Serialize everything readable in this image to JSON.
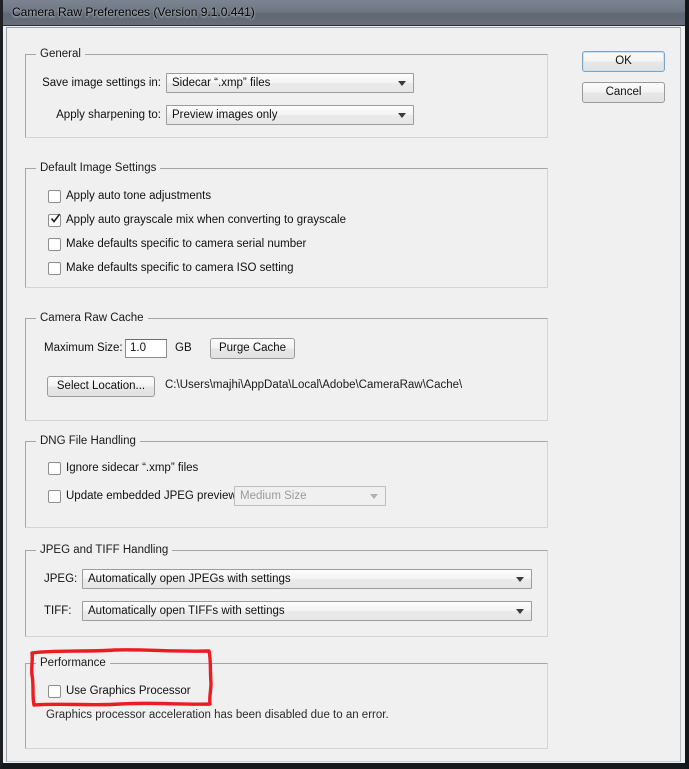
{
  "window": {
    "title": "Camera Raw Preferences  (Version 9.1.0.441)"
  },
  "buttons": {
    "ok": "OK",
    "cancel": "Cancel"
  },
  "groups": {
    "general": {
      "title": "General",
      "save_label": "Save image settings in:",
      "save_value": "Sidecar “.xmp” files",
      "sharpen_label": "Apply sharpening to:",
      "sharpen_value": "Preview images only"
    },
    "default_image_settings": {
      "title": "Default Image Settings",
      "items": [
        {
          "label": "Apply auto tone adjustments",
          "checked": false
        },
        {
          "label": "Apply auto grayscale mix when converting to grayscale",
          "checked": true
        },
        {
          "label": "Make defaults specific to camera serial number",
          "checked": false
        },
        {
          "label": "Make defaults specific to camera ISO setting",
          "checked": false
        }
      ]
    },
    "camera_raw_cache": {
      "title": "Camera Raw Cache",
      "max_size_label": "Maximum Size:",
      "max_size_value": "1.0",
      "unit_label": "GB",
      "purge_button": "Purge Cache",
      "select_location_button": "Select Location...",
      "cache_path": "C:\\Users\\majhi\\AppData\\Local\\Adobe\\CameraRaw\\Cache\\"
    },
    "dng_file_handling": {
      "title": "DNG File Handling",
      "ignore_sidecar": {
        "label": "Ignore sidecar “.xmp” files",
        "checked": false
      },
      "update_previews": {
        "label": "Update embedded JPEG previews:",
        "checked": false
      },
      "preview_size_value": "Medium Size"
    },
    "jpeg_tiff_handling": {
      "title": "JPEG and TIFF Handling",
      "jpeg_label": "JPEG:",
      "jpeg_value": "Automatically open JPEGs with settings",
      "tiff_label": "TIFF:",
      "tiff_value": "Automatically open TIFFs with settings"
    },
    "performance": {
      "title": "Performance",
      "use_gpu": {
        "label": "Use Graphics Processor",
        "checked": false
      },
      "hint": "Graphics processor acceleration has been disabled due to an error."
    }
  },
  "annotation": {
    "color": "#ed1c24",
    "shape": "hand-drawn-rectangle"
  }
}
